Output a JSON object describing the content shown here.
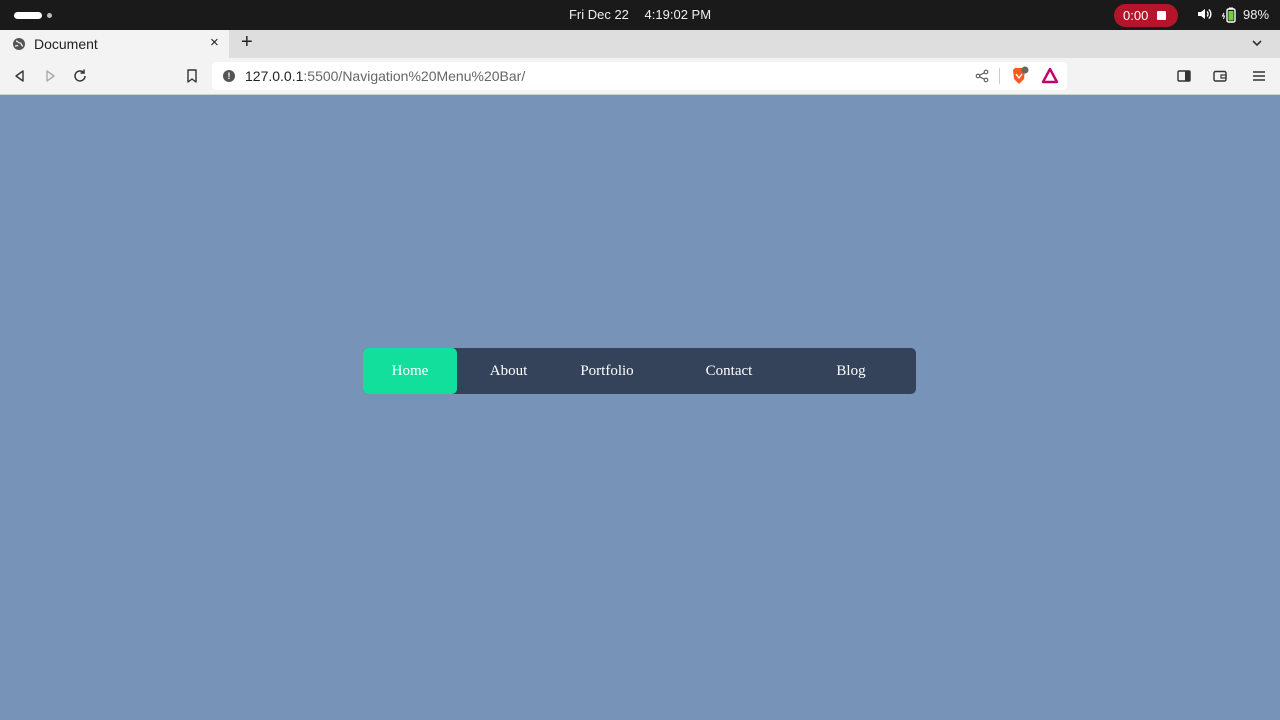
{
  "os": {
    "date": "Fri Dec 22",
    "time": "4:19:02 PM",
    "recording_time": "0:00",
    "battery": "98%"
  },
  "browser": {
    "tab_title": "Document",
    "tab_close": "×",
    "new_tab": "+",
    "url_host": "127.0.0.1",
    "url_path": ":5500/Navigation%20Menu%20Bar/"
  },
  "page": {
    "background_color": "#7893b8",
    "nav_background": "#34435a",
    "active_color": "#13df9c",
    "nav": {
      "items": [
        {
          "label": "Home",
          "active": true
        },
        {
          "label": "About",
          "active": false
        },
        {
          "label": "Portfolio",
          "active": false
        },
        {
          "label": "Contact",
          "active": false
        },
        {
          "label": "Blog",
          "active": false
        }
      ]
    }
  }
}
